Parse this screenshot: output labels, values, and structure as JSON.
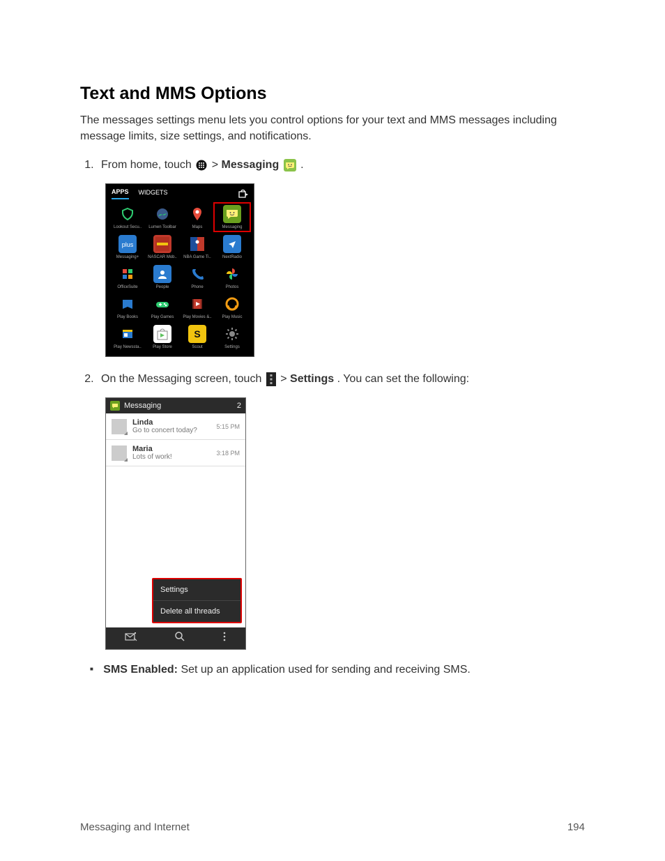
{
  "heading": "Text and MMS Options",
  "intro": "The messages settings menu lets you control options for your text and MMS messages including message limits, size settings, and notifications.",
  "step1_pre": "From home, touch ",
  "step1_gt": " > ",
  "step1_messaging": "Messaging",
  "step1_post": " .",
  "apps_screenshot": {
    "tab_apps": "APPS",
    "tab_widgets": "WIDGETS",
    "grid": [
      {
        "label": "Lookout Secu..",
        "color": "#1a1a1a",
        "svg": "lookout"
      },
      {
        "label": "Lumen Toolbar",
        "color": "#1a1a1a",
        "svg": "globe"
      },
      {
        "label": "Maps",
        "color": "#1a1a1a",
        "svg": "maps"
      },
      {
        "label": "Messaging",
        "color": "#6aa01f",
        "svg": "msg",
        "highlighted": true
      },
      {
        "label": "Messaging+",
        "color": "#2a7bcf",
        "svg": "plus"
      },
      {
        "label": "NASCAR Mob..",
        "color": "#c0392b",
        "svg": "nascar"
      },
      {
        "label": "NBA Game Ti..",
        "color": "#1a1a1a",
        "svg": "nba"
      },
      {
        "label": "NextRadio",
        "color": "#2a7bcf",
        "svg": "radio"
      },
      {
        "label": "OfficeSuite",
        "color": "#1a1a1a",
        "svg": "office"
      },
      {
        "label": "People",
        "color": "#2a7bcf",
        "svg": "people"
      },
      {
        "label": "Phone",
        "color": "#1a1a1a",
        "svg": "phone"
      },
      {
        "label": "Photos",
        "color": "#1a1a1a",
        "svg": "photos"
      },
      {
        "label": "Play Books",
        "color": "#1a1a1a",
        "svg": "books"
      },
      {
        "label": "Play Games",
        "color": "#1a1a1a",
        "svg": "games"
      },
      {
        "label": "Play Movies &..",
        "color": "#1a1a1a",
        "svg": "movies"
      },
      {
        "label": "Play Music",
        "color": "#1a1a1a",
        "svg": "music"
      },
      {
        "label": "Play Newssta..",
        "color": "#1a1a1a",
        "svg": "news"
      },
      {
        "label": "Play Store",
        "color": "#fff",
        "svg": "store"
      },
      {
        "label": "Scout",
        "color": "#f1c40f",
        "svg": "scout"
      },
      {
        "label": "Settings",
        "color": "#1a1a1a",
        "svg": "settings"
      }
    ]
  },
  "step2_pre": "On the Messaging screen, touch ",
  "step2_gt": " > ",
  "step2_settings": "Settings",
  "step2_post": ". You can set the following:",
  "msg_screenshot": {
    "title": "Messaging",
    "count": "2",
    "threads": [
      {
        "name": "Linda",
        "preview": "Go to concert today?",
        "time": "5:15 PM"
      },
      {
        "name": "Maria",
        "preview": "Lots of work!",
        "time": "3:18 PM"
      }
    ],
    "menu": {
      "settings": "Settings",
      "delete": "Delete all threads"
    }
  },
  "bullet_label": "SMS Enabled:",
  "bullet_text": " Set up an application used for sending and receiving SMS.",
  "footer_section": "Messaging and Internet",
  "footer_page": "194"
}
